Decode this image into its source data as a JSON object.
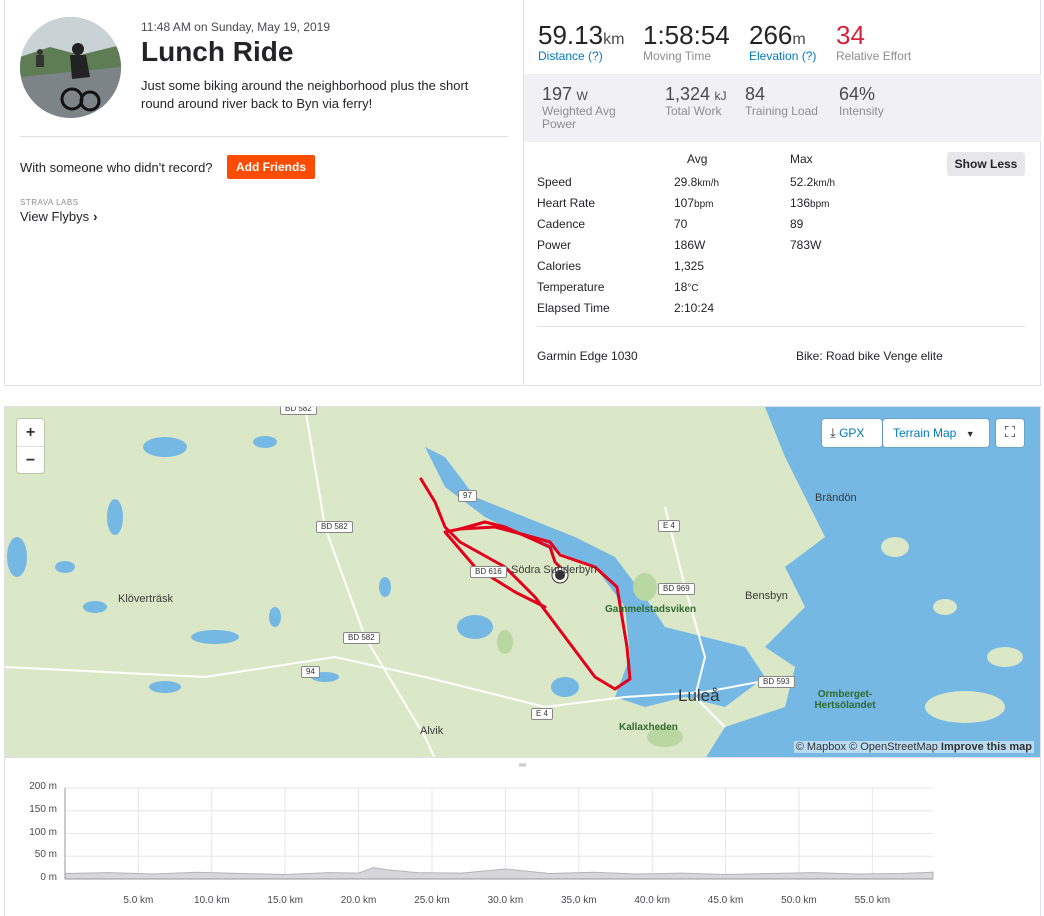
{
  "activity": {
    "timestamp": "11:48 AM on Sunday, May 19, 2019",
    "title": "Lunch Ride",
    "description": "Just some biking around the neighborhood plus the short round around river back to Byn via ferry!",
    "with_someone": "With someone who didn't record?",
    "add_friends_label": "Add Friends",
    "labs_label": "STRAVA LABS",
    "flybys_label": "View Flybys",
    "flybys_chevron": "›"
  },
  "primary_stats": [
    {
      "value": "59.13",
      "unit": "km",
      "label": "Distance (?)"
    },
    {
      "value": "1:58:54",
      "unit": "",
      "label": "Moving Time"
    },
    {
      "value": "266",
      "unit": "m",
      "label": "Elevation (?)"
    },
    {
      "value": "34",
      "unit": "",
      "label": "Relative Effort"
    }
  ],
  "secondary_stats": [
    {
      "value": "197",
      "unit": "W",
      "label": "Weighted Avg",
      "label2": "Power"
    },
    {
      "value": "1,324",
      "unit": "kJ",
      "label": "Total Work",
      "label2": ""
    },
    {
      "value": "84",
      "unit": "",
      "label": "Training Load",
      "label2": ""
    },
    {
      "value": "64%",
      "unit": "",
      "label": "Intensity",
      "label2": ""
    }
  ],
  "more_stats": {
    "show_less_label": "Show Less",
    "avg_header": "Avg",
    "max_header": "Max",
    "rows": [
      {
        "name": "Speed",
        "avg": "29.8",
        "avg_unit": "km/h",
        "max": "52.2",
        "max_unit": "km/h"
      },
      {
        "name": "Heart Rate",
        "avg": "107",
        "avg_unit": "bpm",
        "max": "136",
        "max_unit": "bpm"
      },
      {
        "name": "Cadence",
        "avg": "70",
        "avg_unit": "",
        "max": "89",
        "max_unit": ""
      },
      {
        "name": "Power",
        "avg": "186",
        "avg_unit": "W",
        "max": "783",
        "max_unit": "W"
      },
      {
        "name": "Calories",
        "avg": "1,325",
        "avg_unit": "",
        "max": "",
        "max_unit": ""
      },
      {
        "name": "Temperature",
        "avg": "18",
        "avg_unit": "°C",
        "max": "",
        "max_unit": ""
      },
      {
        "name": "Elapsed Time",
        "avg": "2:10:24",
        "avg_unit": "",
        "max": "",
        "max_unit": ""
      }
    ],
    "device": "Garmin Edge 1030",
    "bike": "Bike: Road bike Venge elite"
  },
  "map": {
    "zoom_in": "+",
    "zoom_out": "−",
    "gpx_label": "GPX",
    "terrain_label": "Terrain Map",
    "attribution_a": "© Mapbox © OpenStreetMap",
    "attribution_b": "Improve this map",
    "places": [
      "Klöverträsk",
      "Södra Sunderbyn",
      "Gammelstadsviken",
      "Bensbyn",
      "Brändön",
      "Luleå",
      "Kallaxheden",
      "Ormberget-Hertsölandet",
      "Alvik"
    ],
    "shields": [
      "BD 582",
      "97",
      "BD 582",
      "E 4",
      "BD 616",
      "BD 969",
      "BD 582",
      "94",
      "BD 593",
      "E 4"
    ],
    "route_color": "#e3001b",
    "water_color": "#75b8e4",
    "land_color": "#dbe8c8"
  },
  "chart_data": {
    "type": "area",
    "title": "",
    "xlabel": "",
    "ylabel": "",
    "y_ticks": [
      "200 m",
      "150 m",
      "100 m",
      "50 m",
      "0 m"
    ],
    "x_ticks": [
      "5.0 km",
      "10.0 km",
      "15.0 km",
      "20.0 km",
      "25.0 km",
      "30.0 km",
      "35.0 km",
      "40.0 km",
      "45.0 km",
      "50.0 km",
      "55.0 km"
    ],
    "ylim": [
      0,
      200
    ],
    "xlim": [
      0,
      59.13
    ],
    "x": [
      0,
      3,
      6,
      9,
      12,
      15,
      18,
      20,
      21,
      22,
      24,
      27,
      30,
      33,
      36,
      39,
      42,
      45,
      48,
      51,
      54,
      57,
      59.13
    ],
    "y": [
      12,
      14,
      11,
      15,
      12,
      10,
      14,
      13,
      25,
      20,
      14,
      13,
      22,
      12,
      15,
      11,
      13,
      10,
      12,
      14,
      11,
      12,
      15
    ],
    "grid": true
  }
}
